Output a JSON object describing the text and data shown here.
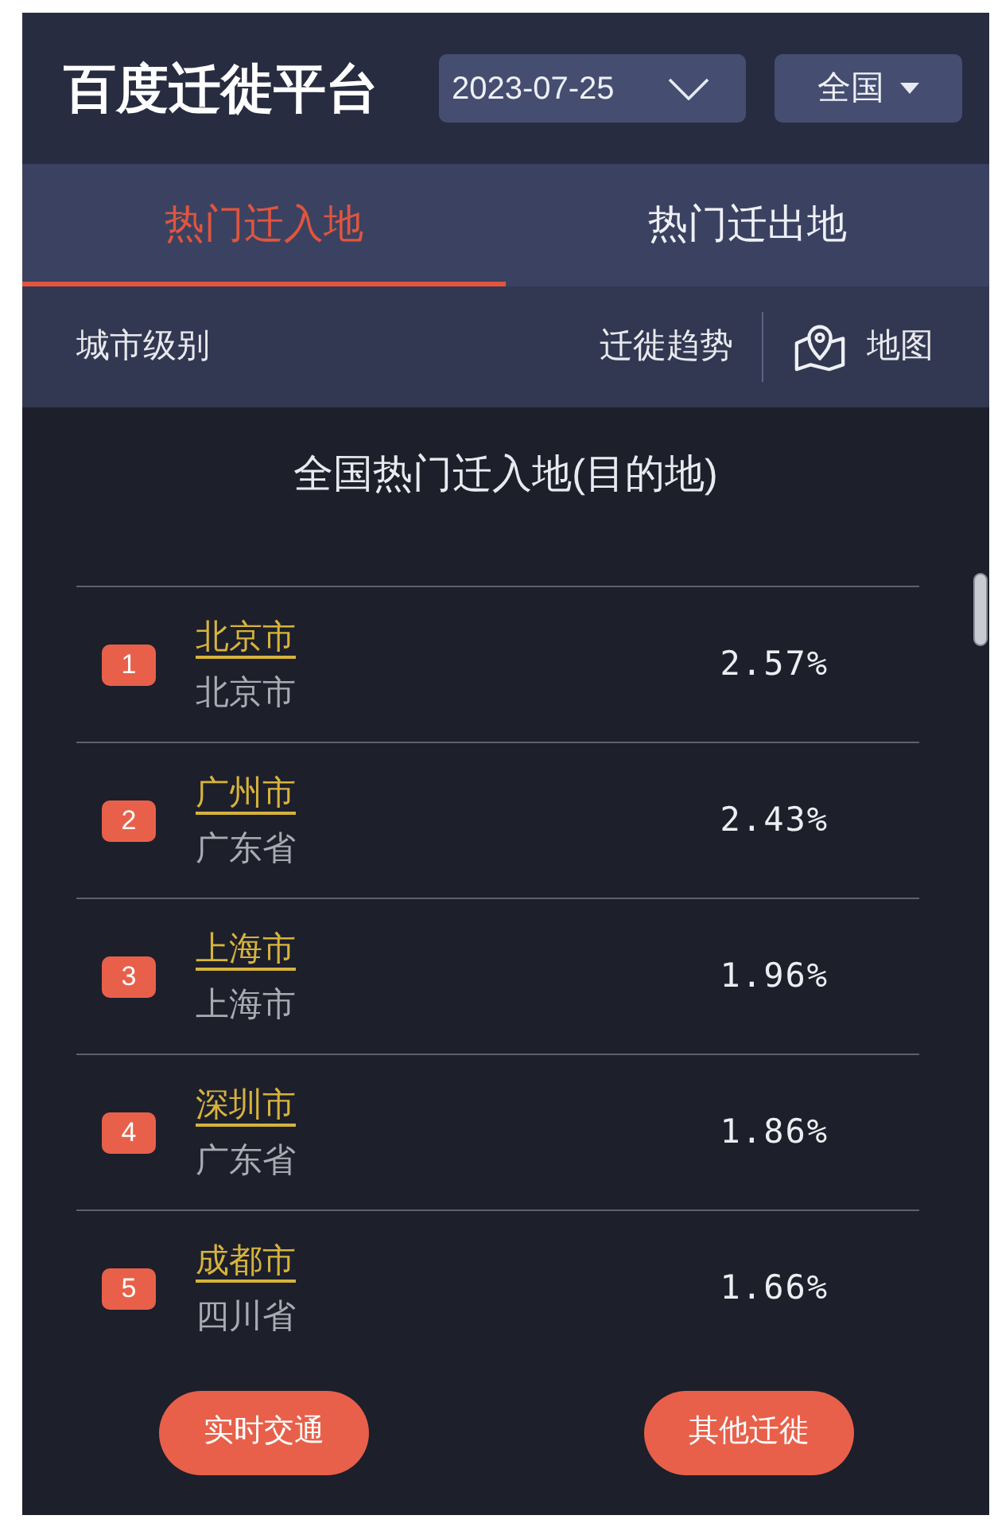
{
  "header": {
    "logo": "百度迁徙平台",
    "date_picker": {
      "value": "2023-07-25"
    },
    "region_picker": {
      "value": "全国"
    }
  },
  "tabs": [
    {
      "label": "热门迁入地",
      "selected": true
    },
    {
      "label": "热门迁出地",
      "selected": false
    }
  ],
  "toolbar": {
    "city_level": "城市级别",
    "trend": "迁徙趋势",
    "map": "地图"
  },
  "ranking": {
    "title": "全国热门迁入地(目的地)",
    "rows": [
      {
        "rank": "1",
        "city": "北京市",
        "province": "北京市",
        "share": "2.57%"
      },
      {
        "rank": "2",
        "city": "广州市",
        "province": "广东省",
        "share": "2.43%"
      },
      {
        "rank": "3",
        "city": "上海市",
        "province": "上海市",
        "share": "1.96%"
      },
      {
        "rank": "4",
        "city": "深圳市",
        "province": "广东省",
        "share": "1.86%"
      },
      {
        "rank": "5",
        "city": "成都市",
        "province": "四川省",
        "share": "1.66%"
      }
    ]
  },
  "buttons": [
    {
      "label": "实时交通"
    },
    {
      "label": "其他迁徙"
    }
  ]
}
